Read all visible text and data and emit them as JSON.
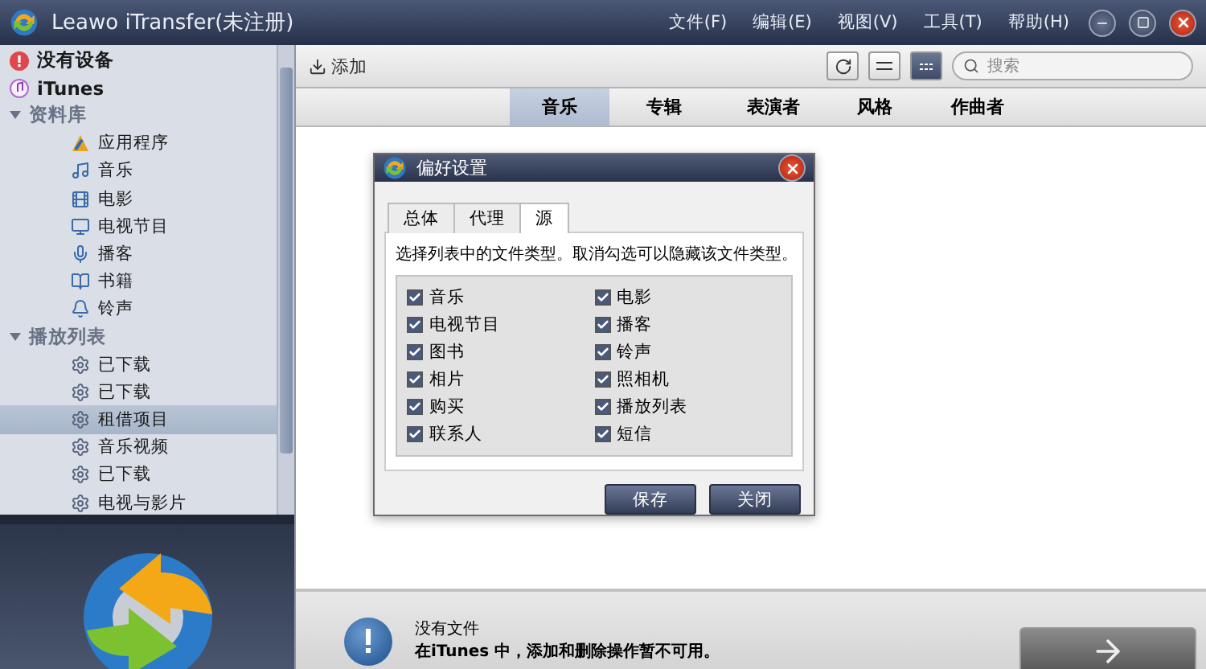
{
  "window": {
    "title": "Leawo iTransfer(未注册)"
  },
  "menu": [
    "文件(F)",
    "编辑(E)",
    "视图(V)",
    "工具(T)",
    "帮助(H)"
  ],
  "sidebar": {
    "items": [
      {
        "kind": "device",
        "label": "没有设备",
        "selected": false
      },
      {
        "kind": "itunes",
        "label": "iTunes",
        "selected": false
      },
      {
        "kind": "group",
        "label": "资料库",
        "expanded": true,
        "children": [
          {
            "kind": "apps",
            "label": "应用程序",
            "selected": false
          },
          {
            "kind": "music",
            "label": "音乐",
            "selected": false
          },
          {
            "kind": "movie",
            "label": "电影",
            "selected": false
          },
          {
            "kind": "tv",
            "label": "电视节目",
            "selected": false
          },
          {
            "kind": "podcast",
            "label": "播客",
            "selected": false
          },
          {
            "kind": "book",
            "label": "书籍",
            "selected": false
          },
          {
            "kind": "ringtone",
            "label": "铃声",
            "selected": false
          }
        ]
      },
      {
        "kind": "group",
        "label": "播放列表",
        "expanded": true,
        "children": [
          {
            "kind": "playlist",
            "label": "已下载",
            "selected": false
          },
          {
            "kind": "playlist",
            "label": "已下载",
            "selected": false
          },
          {
            "kind": "playlist",
            "label": "租借项目",
            "selected": true
          },
          {
            "kind": "playlist",
            "label": "音乐视频",
            "selected": false
          },
          {
            "kind": "playlist",
            "label": "已下载",
            "selected": false
          },
          {
            "kind": "playlist",
            "label": "电视与影片",
            "selected": false
          }
        ]
      }
    ]
  },
  "toolbar": {
    "add": "添加",
    "search": {
      "placeholder": "搜索"
    },
    "view_list_selected": false
  },
  "columns": [
    {
      "label": "音乐",
      "selected": true
    },
    {
      "label": "专辑",
      "selected": false
    },
    {
      "label": "表演者",
      "selected": false
    },
    {
      "label": "风格",
      "selected": false
    },
    {
      "label": "作曲者",
      "selected": false
    }
  ],
  "dialog": {
    "title": "偏好设置",
    "tabs": [
      {
        "label": "总体",
        "selected": false
      },
      {
        "label": "代理",
        "selected": false
      },
      {
        "label": "源",
        "selected": true
      }
    ],
    "hint": "选择列表中的文件类型。取消勾选可以隐藏该文件类型。",
    "options": [
      {
        "label": "音乐",
        "checked": true
      },
      {
        "label": "电影",
        "checked": true
      },
      {
        "label": "电视节目",
        "checked": true
      },
      {
        "label": "播客",
        "checked": true
      },
      {
        "label": "图书",
        "checked": true
      },
      {
        "label": "铃声",
        "checked": true
      },
      {
        "label": "相片",
        "checked": true
      },
      {
        "label": "照相机",
        "checked": true
      },
      {
        "label": "购买",
        "checked": true
      },
      {
        "label": "播放列表",
        "checked": true
      },
      {
        "label": "联系人",
        "checked": true
      },
      {
        "label": "短信",
        "checked": true
      }
    ],
    "buttons": [
      "保存",
      "关闭"
    ]
  },
  "status": {
    "title": "没有文件",
    "message": "在iTunes 中，添加和删除操作暂不可用。"
  }
}
